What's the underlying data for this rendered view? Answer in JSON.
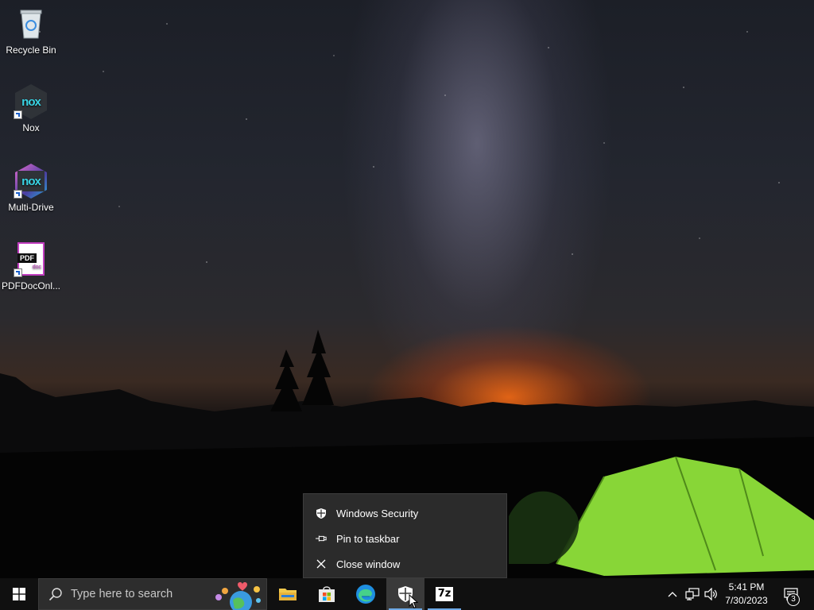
{
  "desktop": {
    "icons": [
      {
        "label": "Recycle Bin"
      },
      {
        "label": "Nox",
        "logo": "nox"
      },
      {
        "label": "Multi-Drive",
        "logo": "nox"
      },
      {
        "label": "PDFDocOnl...",
        "badge": "PDF",
        "sub": "doc"
      }
    ]
  },
  "context_menu": {
    "items": [
      {
        "label": "Windows Security",
        "icon": "shield-icon"
      },
      {
        "label": "Pin to taskbar",
        "icon": "pin-icon"
      },
      {
        "label": "Close window",
        "icon": "close-icon"
      }
    ]
  },
  "taskbar": {
    "search_placeholder": "Type here to search",
    "apps": [
      "file-explorer",
      "microsoft-store",
      "edge",
      "windows-security",
      "7-zip"
    ],
    "seven_zip_label": "7z",
    "clock": {
      "time": "5:41 PM",
      "date": "7/30/2023"
    },
    "notifications_count": "3"
  },
  "colors": {
    "taskbar_bg": "#101010",
    "menu_bg": "#2b2b2b",
    "accent": "#6ea9e6",
    "tent_green": "#8fe23a"
  }
}
